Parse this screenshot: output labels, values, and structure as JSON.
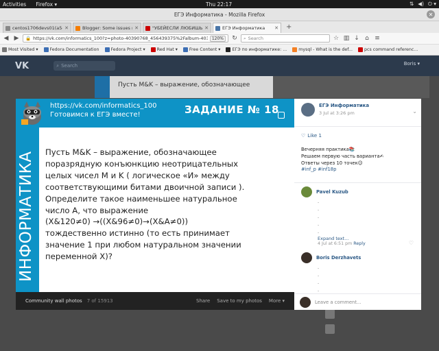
{
  "os": {
    "activities": "Activities",
    "app": "Firefox ▾",
    "clock": "Thu 22:17"
  },
  "window": {
    "title": "ЕГЭ Информатика - Mozilla Firefox"
  },
  "tabs": [
    {
      "label": "centos1706devs01(a5eb01c:",
      "color": "#888"
    },
    {
      "label": "Blogger: Some issues re",
      "color": "#f57d00"
    },
    {
      "label": "\"УБЕЙЕСЛИ ЛЮБИШЬ",
      "color": "#cc0000"
    },
    {
      "label": "ЕГЭ Информатика",
      "color": "#4a76a8"
    }
  ],
  "nav": {
    "url": "https://vk.com/informatics_100?z=photo-40390768_456439375%2Falbum-40390768_00",
    "zoom": "120%",
    "search_placeholder": "Search"
  },
  "bookmarks": [
    {
      "label": "Most Visited ▾",
      "color": "#777"
    },
    {
      "label": "Fedora Documentation",
      "color": "#3c6eb4"
    },
    {
      "label": "Fedora Project ▾",
      "color": "#3c6eb4"
    },
    {
      "label": "Red Hat ▾",
      "color": "#cc0000"
    },
    {
      "label": "Free Content ▾",
      "color": "#3c6eb4"
    },
    {
      "label": "ЕГЭ по информатике: ...",
      "color": "#222"
    },
    {
      "label": "mysql - What is the def...",
      "color": "#f48024"
    },
    {
      "label": "pcs command referenc...",
      "color": "#cc0000"
    }
  ],
  "vk": {
    "logo": "VK",
    "search": "Search",
    "user": "Boris ▾",
    "bg_post": "Пусть M&K – выражение, обозначающее"
  },
  "photo": {
    "link": "https://vk.com/informatics_100",
    "subtitle": "Готовимся к ЕГЭ вместе!",
    "task_title": "ЗАДАНИЕ № 18",
    "vertical": "ИНФОРМАТИКА",
    "task_lines": [
      "Пусть M&K – выражение, обозначающее",
      "поразрядную конъюнкцию неотрицательных",
      "целых чисел M и K  ( логическое «И» между",
      "соответствующими битами двоичной записи ).",
      "Определите такое наименьшее натуральное",
      "число A, что выражение",
      "(X&120≠0) →((X&96≠0)→(X&A≠0))",
      "тождественно истинно  (то есть принимает",
      "значение 1 при любом натуральном значении",
      "переменной X)?"
    ],
    "toolbar": {
      "label": "Community wall photos",
      "count": "7 of 15913",
      "share": "Share",
      "save": "Save to my photos",
      "more": "More ▾"
    }
  },
  "post": {
    "owner": "ЕГЭ Информатика",
    "date": "3 Jul at 3:26 pm",
    "like": "Like 1",
    "text_lines": [
      "Вечерняя практика📚",
      "Решаем первую часть варианта✍",
      "Ответы через 10 точек😉"
    ],
    "tags": "#inf_p #inf18p"
  },
  "comments": [
    {
      "name": "Pavel Kuzub",
      "lines": [
        ".",
        ".",
        ".",
        ".",
        "."
      ],
      "expand": "Expand text...",
      "date": "4 Jul at 6:51 pm",
      "reply": "Reply"
    },
    {
      "name": "Boris Derzhavets",
      "lines": [
        ".",
        ".",
        ".",
        "."
      ]
    }
  ],
  "leave": "Leave a comment..."
}
